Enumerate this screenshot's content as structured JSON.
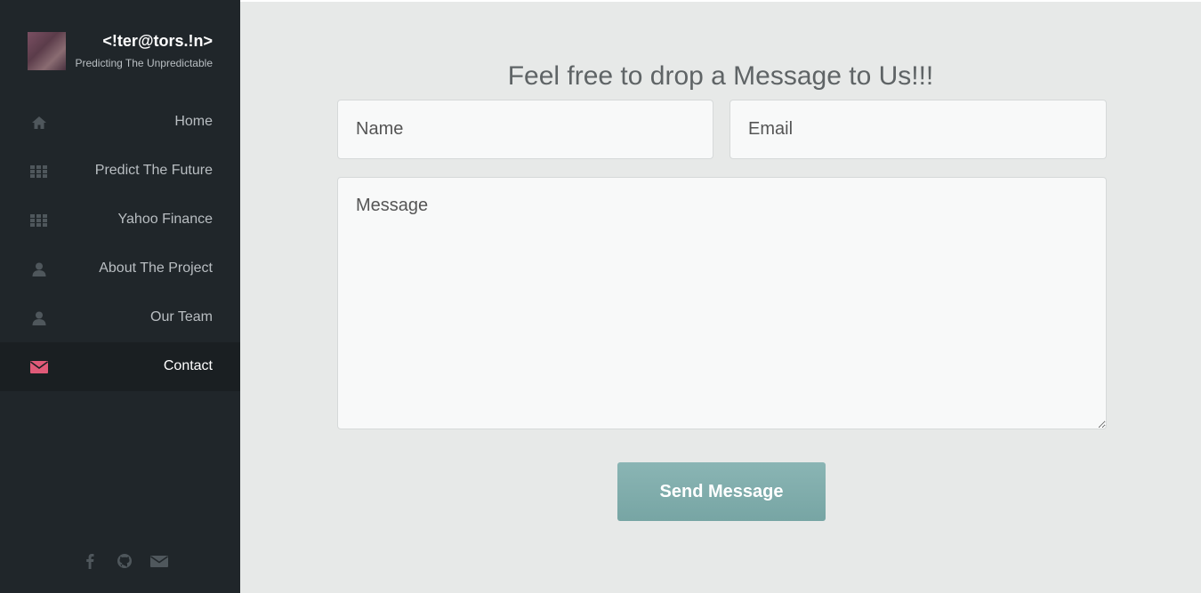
{
  "sidebar": {
    "brand_title": "<!ter@tors.!n>",
    "brand_subtitle": "Predicting The Unpredictable",
    "items": [
      {
        "label": "Home",
        "icon": "home-icon"
      },
      {
        "label": "Predict The Future",
        "icon": "grid-icon"
      },
      {
        "label": "Yahoo Finance",
        "icon": "grid-icon"
      },
      {
        "label": "About The Project",
        "icon": "user-icon"
      },
      {
        "label": "Our Team",
        "icon": "user-icon"
      },
      {
        "label": "Contact",
        "icon": "envelope-icon",
        "active": true
      }
    ],
    "social": [
      "facebook-icon",
      "github-icon",
      "envelope-icon"
    ]
  },
  "main": {
    "heading": "Feel free to drop a Message to Us!!!",
    "form": {
      "name_placeholder": "Name",
      "email_placeholder": "Email",
      "message_placeholder": "Message",
      "submit_label": "Send Message"
    }
  },
  "colors": {
    "sidebar_bg": "#20262a",
    "active_item_bg": "#1a1f22",
    "accent_icon": "#e05a78",
    "button": "#82afae",
    "content_bg": "#e7e9e8"
  }
}
